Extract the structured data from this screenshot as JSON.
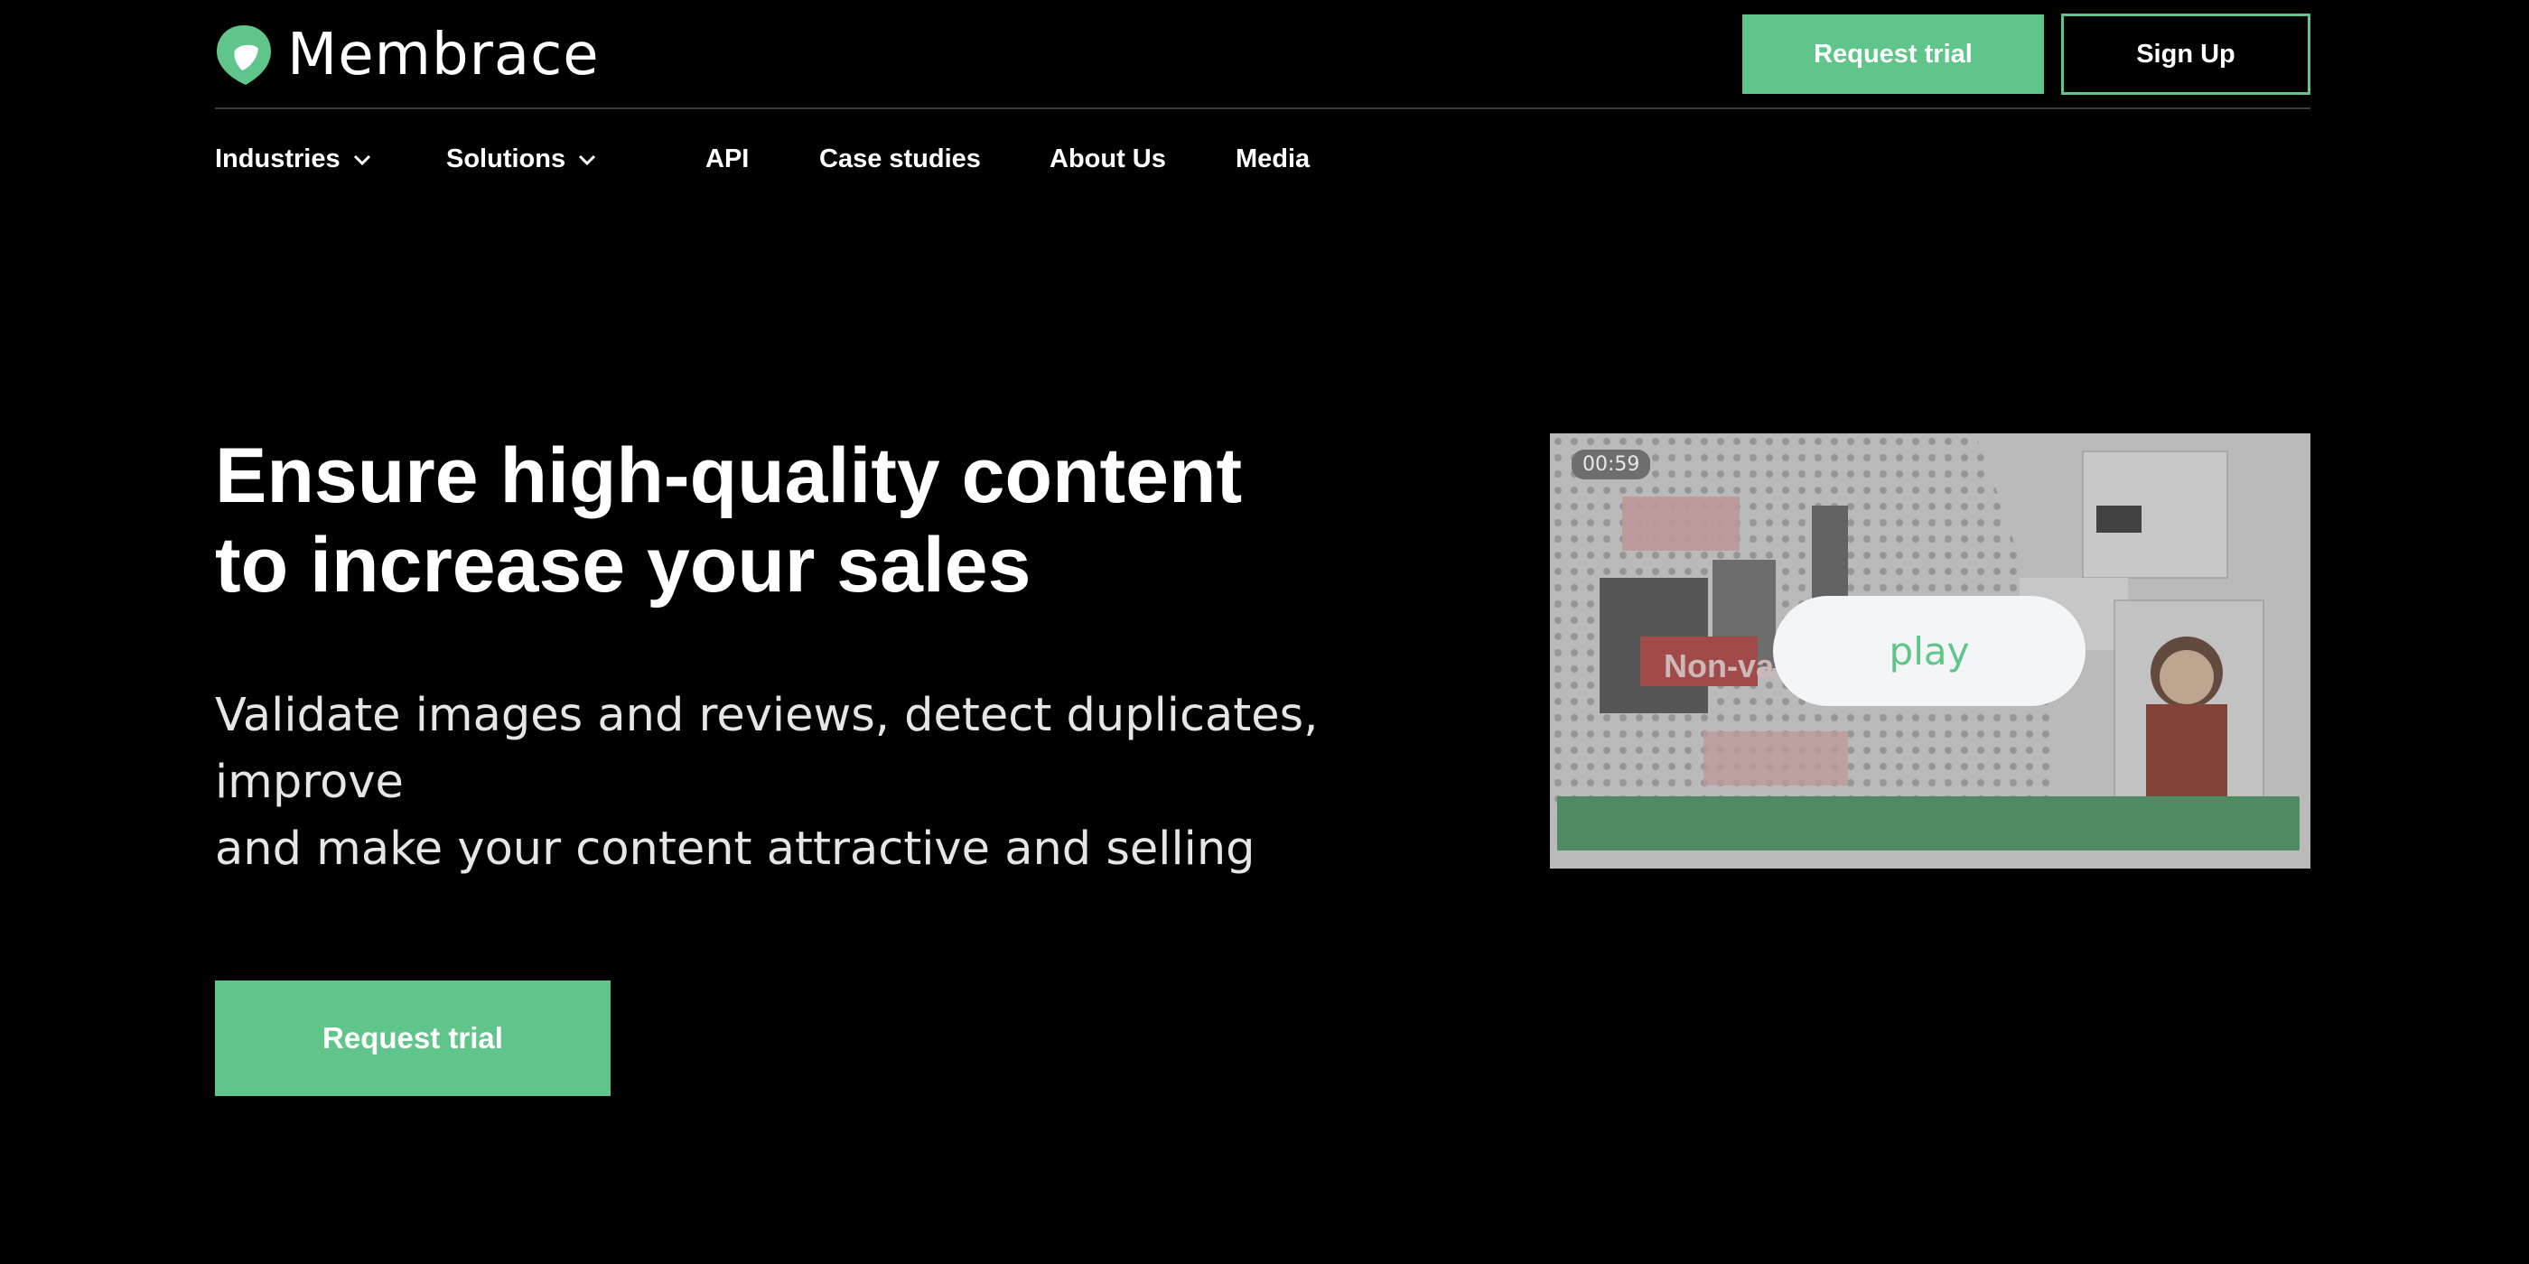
{
  "header": {
    "brand": "Membrace",
    "request_trial_label": "Request trial",
    "sign_up_label": "Sign Up"
  },
  "nav": {
    "items": [
      {
        "label": "Industries",
        "has_dropdown": true
      },
      {
        "label": "Solutions",
        "has_dropdown": true
      },
      {
        "label": "API",
        "has_dropdown": false
      },
      {
        "label": "Case studies",
        "has_dropdown": false
      },
      {
        "label": "About Us",
        "has_dropdown": false
      },
      {
        "label": "Media",
        "has_dropdown": false
      }
    ]
  },
  "hero": {
    "title_line1": "Ensure high-quality content",
    "title_line2": "to increase your sales",
    "subtitle_line1": "Validate images and reviews, detect duplicates, improve",
    "subtitle_line2": "and make your content attractive and selling",
    "cta_label": "Request trial"
  },
  "video": {
    "duration": "00:59",
    "play_label": "play",
    "overlay_text": "Non-val"
  },
  "colors": {
    "accent": "#5fc58a",
    "background": "#000000",
    "text": "#ffffff"
  },
  "icons": {
    "logo": "membrace-logo-icon",
    "dropdown": "chevron-down-icon"
  }
}
